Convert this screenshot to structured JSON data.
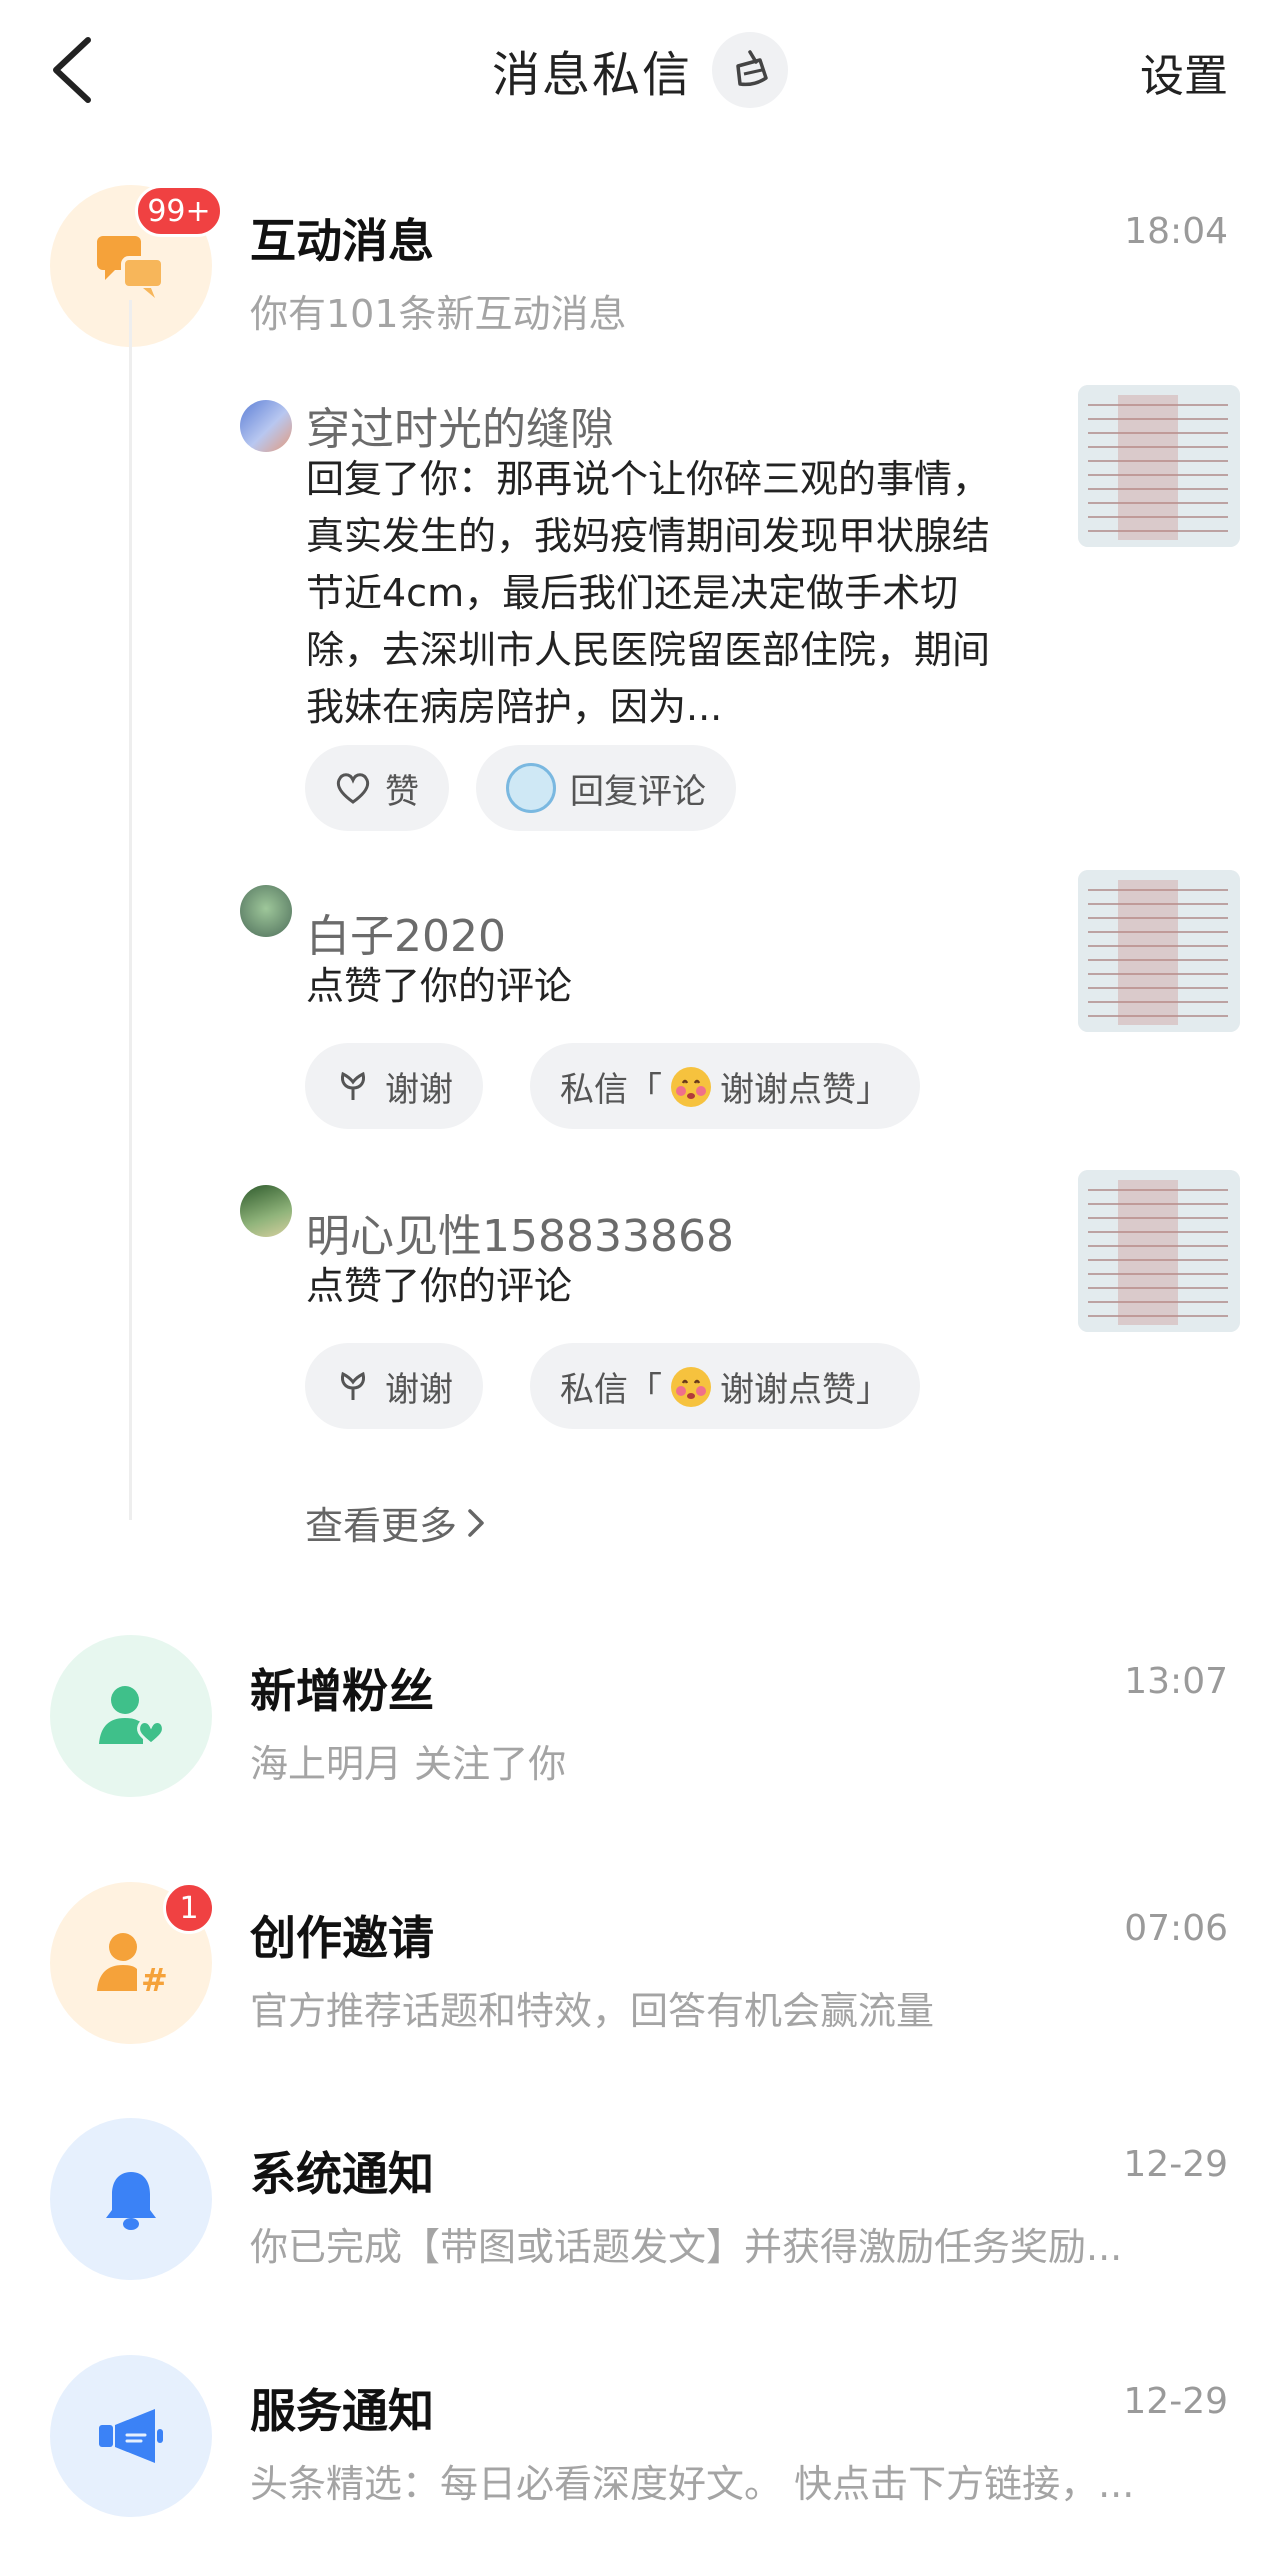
{
  "header": {
    "title": "消息私信",
    "settings_label": "设置"
  },
  "interaction": {
    "title": "互动消息",
    "time": "18:04",
    "subtitle": "你有101条新互动消息",
    "badge": "99+",
    "items": [
      {
        "user": "穿过时光的缝隙",
        "text": "回复了你：那再说个让你碎三观的事情，真实发生的，我妈疫情期间发现甲状腺结节近4cm，最后我们还是决定做手术切除，去深圳市人民医院留医部住院，期间我妹在病房陪护，因为...",
        "actions": [
          "赞",
          "回复评论"
        ]
      },
      {
        "user": "白子2020",
        "text": "点赞了你的评论",
        "actions": [
          "谢谢",
          "私信「",
          "谢谢点赞」"
        ]
      },
      {
        "user": "明心见性158833868",
        "text": "点赞了你的评论",
        "actions": [
          "谢谢",
          "私信「",
          "谢谢点赞」"
        ]
      }
    ],
    "more_label": "查看更多"
  },
  "rows": [
    {
      "title": "新增粉丝",
      "time": "13:07",
      "subtitle": "海上明月 关注了你",
      "icon": "follower-icon",
      "color": "#3fc08a",
      "bg": "#e7f7ef"
    },
    {
      "title": "创作邀请",
      "time": "07:06",
      "subtitle": "官方推荐话题和特效，回答有机会赢流量",
      "icon": "creator-icon",
      "color": "#f5a23a",
      "bg": "#fff2e0",
      "badge": "1"
    },
    {
      "title": "系统通知",
      "time": "12-29",
      "subtitle": "你已完成【带图或话题发文】并获得激励任务奖励...",
      "icon": "bell-icon",
      "color": "#3b82f6",
      "bg": "#e6f0fd"
    },
    {
      "title": "服务通知",
      "time": "12-29",
      "subtitle": "头条精选：每日必看深度好文。 快点击下方链接，...",
      "icon": "megaphone-icon",
      "color": "#3b82f6",
      "bg": "#e6f0fd"
    }
  ],
  "colors": {
    "accent_red": "#f04142",
    "interaction_icon": "#f5a23a",
    "interaction_bg": "#fff2e0"
  }
}
